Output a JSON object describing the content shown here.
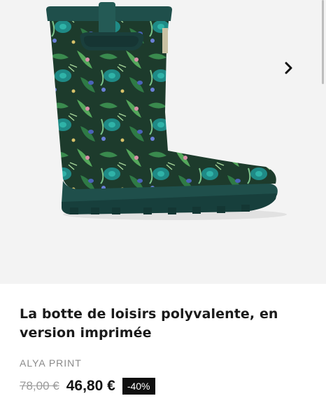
{
  "product": {
    "title": "La botte de loisirs polyvalente, en version imprimée",
    "brand": "ALYA PRINT",
    "old_price": "78,00 €",
    "new_price": "46,80 €",
    "discount": "-40%"
  },
  "gallery": {
    "next_icon": "chevron-right-icon",
    "image_alt": "rain-boot-floral-print"
  },
  "colors": {
    "boot_rubber": "#1f4f4b",
    "foliage_dark": "#1d3b2c",
    "foliage_green": "#2f7a45",
    "teal_flower": "#1f8a86",
    "badge_bg": "#0f0f0f"
  }
}
